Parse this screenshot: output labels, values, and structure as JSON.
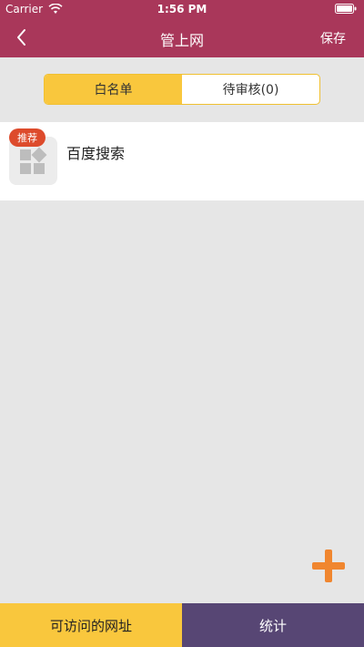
{
  "status_bar": {
    "carrier": "Carrier",
    "time": "1:56 PM"
  },
  "nav": {
    "title": "管上网",
    "save_label": "保存"
  },
  "tabs": {
    "whitelist": "白名单",
    "pending": "待审核(0)"
  },
  "list": {
    "items": [
      {
        "badge": "推荐",
        "title": "百度搜索"
      }
    ]
  },
  "bottom": {
    "left_label": "可访问的网址",
    "right_label": "统计"
  },
  "colors": {
    "header": "#a9375a",
    "accent": "#f9c73d",
    "badge": "#dd4b2c",
    "bottom_right": "#574674",
    "add_icon": "#f0862f"
  },
  "icons": {
    "back": "chevron-left-icon",
    "wifi": "wifi-icon",
    "battery": "battery-icon",
    "app_placeholder": "app-grid-icon",
    "add": "plus-icon"
  }
}
